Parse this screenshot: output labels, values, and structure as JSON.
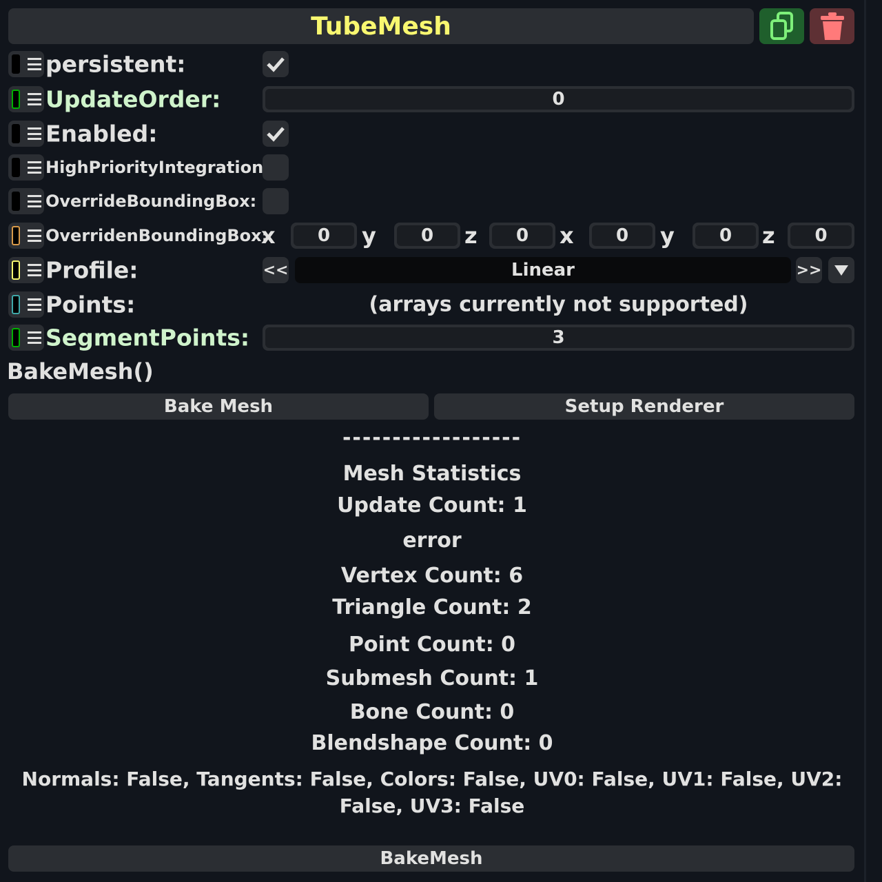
{
  "component": {
    "title": "TubeMesh",
    "duplicate_icon_color": "#7ef07a",
    "delete_icon_color": "#ff7a7a"
  },
  "fields": {
    "persistent": {
      "label": "persistent:",
      "checked": true,
      "swatch": "#000000"
    },
    "update_order": {
      "label": "UpdateOrder:",
      "value": "0",
      "swatch": "#00b000"
    },
    "enabled": {
      "label": "Enabled:",
      "checked": true,
      "swatch": "#000000"
    },
    "high_priority": {
      "label": "HighPriorityIntegration:",
      "checked": false,
      "swatch": "#000000"
    },
    "override_bbox": {
      "label": "OverrideBoundingBox:",
      "checked": false,
      "swatch": "#000000"
    },
    "overriden_bbox": {
      "label": "OverridenBoundingBox:",
      "swatch": "#d89a4a",
      "axes": [
        "x",
        "y",
        "z",
        "x",
        "y",
        "z"
      ],
      "values": [
        "0",
        "0",
        "0",
        "0",
        "0",
        "0"
      ]
    },
    "profile": {
      "label": "Profile:",
      "value": "Linear",
      "prev": "<<",
      "next": ">>",
      "swatch": "#f8f770"
    },
    "points": {
      "label": "Points:",
      "note": "(arrays currently not supported)",
      "swatch": "#3fa8a8"
    },
    "segment_points": {
      "label": "SegmentPoints:",
      "value": "3",
      "swatch": "#00b000"
    }
  },
  "method": {
    "name": "BakeMesh()",
    "bake_button": "Bake Mesh",
    "setup_button": "Setup Renderer"
  },
  "statistics": {
    "divider": "------------------",
    "heading": "Mesh Statistics",
    "update_count": "Update Count: 1",
    "error": "error",
    "vertex_count": "Vertex Count: 6",
    "triangle_count": "Triangle Count: 2",
    "point_count": "Point Count: 0",
    "submesh_count": "Submesh Count: 1",
    "bone_count": "Bone Count: 0",
    "blendshape_count": "Blendshape Count: 0",
    "flags_line1": "Normals: False, Tangents: False, Colors: False, UV0: False, UV1: False, UV2:",
    "flags_line2": "False, UV3: False"
  },
  "footer": {
    "bake_button": "BakeMesh"
  }
}
